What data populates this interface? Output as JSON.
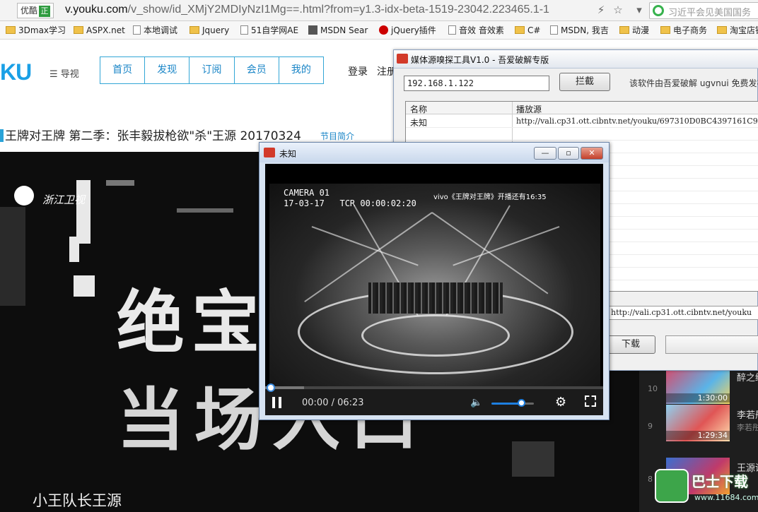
{
  "browser": {
    "badge_label": "优酷",
    "badge_mark": "正",
    "url_domain": "v.youku.com",
    "url_rest": "/v_show/id_XMjY2MDIyNzI1Mg==.html?from=y1.3-idx-beta-1519-23042.223465.1-1",
    "search_text": "习近平会见美国国务"
  },
  "bookmarks": [
    {
      "label": "3Dmax学习",
      "icon": "folder"
    },
    {
      "label": "ASPX.net",
      "icon": "folder"
    },
    {
      "label": "本地调试",
      "icon": "page"
    },
    {
      "label": "Jquery",
      "icon": "folder"
    },
    {
      "label": "51自学网AE",
      "icon": "page"
    },
    {
      "label": "MSDN Sear",
      "icon": "msdn"
    },
    {
      "label": "jQuery插件",
      "icon": "red-circle"
    },
    {
      "label": "音效 音效素",
      "icon": "page"
    },
    {
      "label": "C#",
      "icon": "folder"
    },
    {
      "label": "MSDN, 我吉",
      "icon": "page"
    },
    {
      "label": "动漫",
      "icon": "folder"
    },
    {
      "label": "电子商务",
      "icon": "folder"
    },
    {
      "label": "淘宝店铺",
      "icon": "folder"
    }
  ],
  "site": {
    "logo": "KU",
    "nav_label": "导视",
    "tabs": [
      "首页",
      "发现",
      "订阅",
      "会员",
      "我的"
    ],
    "login": "登录",
    "register": "注册",
    "video_title": "王牌对王牌 第二季：张丰毅拔枪欲\"杀\"王源 20170324",
    "intro_link": "节目简介",
    "channel": "浙江卫视",
    "overlay_line1": "绝宝",
    "overlay_line2": "当场入口",
    "caption": "小王队长王源"
  },
  "playlist": [
    {
      "num": "10",
      "duration": "1:30:00",
      "title": "醉之绿",
      "sub": ""
    },
    {
      "num": "9",
      "duration": "1:29:34",
      "title": "李若彤",
      "sub": "李若彤"
    },
    {
      "num": "8",
      "duration": "",
      "title": "王源讲",
      "sub": ""
    }
  ],
  "tool": {
    "title": "媒体源嗅探工具V1.0  -  吾爱破解专版",
    "ip_value": "192.168.1.122",
    "intercept_label": "拦截",
    "credit": "该软件由吾爱破解 ugvnui 免费发布",
    "col_name": "名称",
    "col_source": "播放源",
    "rows": [
      {
        "name": "未知",
        "source": "http://vali.cp31.ott.cibntv.net/youku/697310D0BC4397161C9"
      }
    ],
    "url_value": "http://vali.cp31.ott.cibntv.net/youku",
    "download_label": "下载"
  },
  "popup": {
    "title": "未知",
    "minimize": "—",
    "maximize": "▫",
    "close": "✕",
    "camera_overlay": "CAMERA 01\n17-03-17   TCR 00:00:02:20",
    "top_banner": "vivo《王牌对王牌》开播还有16:35",
    "time_display": "00:00 / 06:23",
    "played_fraction": 0.0,
    "volume_fraction": 0.72
  },
  "watermark": {
    "title": "巴士下载",
    "url": "www.11684.com"
  }
}
